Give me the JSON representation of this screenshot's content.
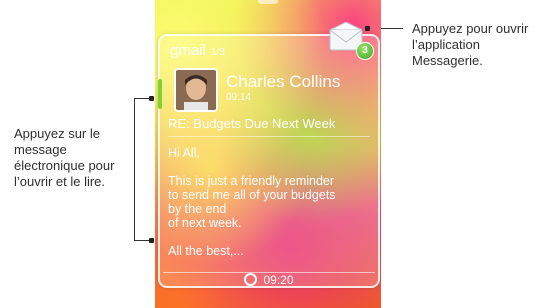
{
  "callouts": {
    "left": "Appuyez sur le message électronique pour l’ouvrir et le lire.",
    "right": "Appuyez pour ouvrir l’application Messagerie."
  },
  "widget": {
    "title": "gmail",
    "pager": "1/3",
    "unread_badge": "3",
    "icons": [
      "envelope-icon",
      "avatar",
      "clock-icon"
    ]
  },
  "email": {
    "sender": "Charles Collins",
    "time": "09:14",
    "subject": "RE: Budgets Due Next Week",
    "body": "Hi All,\n\nThis is just a friendly reminder\nto send me all of your budgets\nby the end\nof next week.\n\nAll the best,..."
  },
  "status": {
    "clock": "09:20"
  }
}
